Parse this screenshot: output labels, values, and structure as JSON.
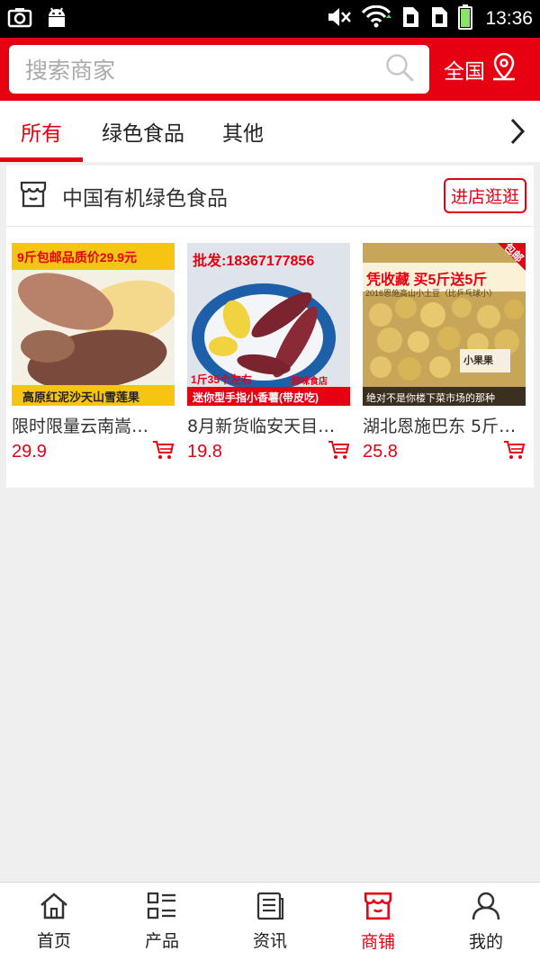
{
  "status_bar": {
    "time": "13:36",
    "icons": [
      "camera-icon",
      "android-icon",
      "mute-icon",
      "wifi-icon",
      "sim1-icon",
      "sim2-icon",
      "battery-icon"
    ]
  },
  "header": {
    "search_placeholder": "搜索商家",
    "region_label": "全国",
    "accent_color": "#e60012"
  },
  "tabs": [
    {
      "label": "所有",
      "active": true
    },
    {
      "label": "绿色食品",
      "active": false
    },
    {
      "label": "其他",
      "active": false
    }
  ],
  "store": {
    "name": "中国有机绿色食品",
    "visit_label": "进店逛逛",
    "products": [
      {
        "title": "限时限量云南嵩…",
        "price": "29.9",
        "img_top_text": "9斤包邮品质价29.9元",
        "img_bottom_text": "高原红泥沙天山雪莲果"
      },
      {
        "title": "8月新货临安天目…",
        "price": "19.8",
        "img_top_text": "批发:18367177856",
        "img_mid_text": "1斤35个左右",
        "img_shop_text": "醉味食店",
        "img_bottom_text": "迷你型手指小香薯(带皮吃)"
      },
      {
        "title": "湖北恩施巴东 5斤…",
        "price": "25.8",
        "img_corner_text": "包邮",
        "img_top_text": "凭收藏 买5斤送5斤",
        "img_sub_text": "2016恩施高山小土豆（比乒乓球小）",
        "img_tag_text": "小果果",
        "img_bottom_text": "绝对不是你楼下菜市场的那种"
      }
    ]
  },
  "bottom_nav": [
    {
      "label": "首页",
      "icon": "home-icon",
      "active": false
    },
    {
      "label": "产品",
      "icon": "product-list-icon",
      "active": false
    },
    {
      "label": "资讯",
      "icon": "news-icon",
      "active": false
    },
    {
      "label": "商铺",
      "icon": "shop-icon",
      "active": true
    },
    {
      "label": "我的",
      "icon": "user-icon",
      "active": false
    }
  ]
}
